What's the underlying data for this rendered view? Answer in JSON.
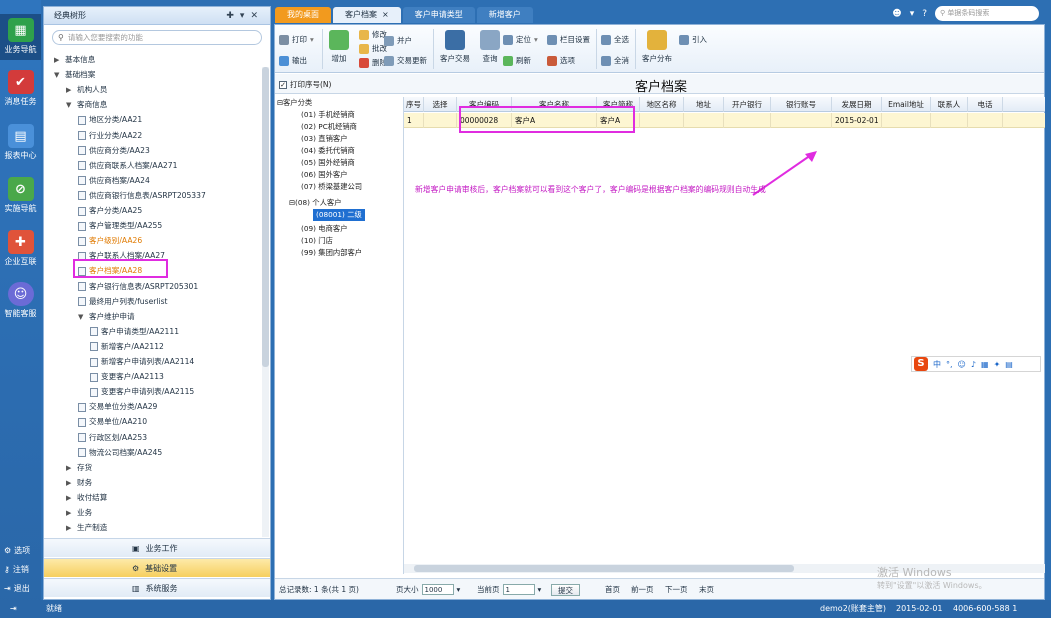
{
  "rail": {
    "items": [
      {
        "label": "业务导航",
        "icon": "grid-icon",
        "color": "#2fa14b",
        "active": true
      },
      {
        "label": "消息任务",
        "icon": "checklist-icon",
        "color": "#d33b3b"
      },
      {
        "label": "报表中心",
        "icon": "chart-icon",
        "color": "#4a90d9"
      },
      {
        "label": "实施导航",
        "icon": "compass-icon",
        "color": "#4aa84a"
      },
      {
        "label": "企业互联",
        "icon": "puzzle-icon",
        "color": "#e0533a"
      },
      {
        "label": "智能客服",
        "icon": "robot-icon",
        "color": "#6b6bd6"
      }
    ],
    "bottom": [
      "选项",
      "注销",
      "退出"
    ]
  },
  "tree_panel": {
    "title": "经典树形",
    "search_placeholder": "请输入您要搜索的功能",
    "rows": [
      {
        "label": "基本信息",
        "arrow": "▶",
        "indent": 0
      },
      {
        "label": "基础档案",
        "arrow": "▼",
        "indent": 0
      },
      {
        "label": "机构人员",
        "arrow": "▶",
        "indent": 1
      },
      {
        "label": "客商信息",
        "arrow": "▼",
        "indent": 1
      },
      {
        "label": "地区分类/AA21",
        "doc": true,
        "indent": 2
      },
      {
        "label": "行业分类/AA22",
        "doc": true,
        "indent": 2
      },
      {
        "label": "供应商分类/AA23",
        "doc": true,
        "indent": 2
      },
      {
        "label": "供应商联系人档案/AA271",
        "doc": true,
        "indent": 2
      },
      {
        "label": "供应商档案/AA24",
        "doc": true,
        "indent": 2
      },
      {
        "label": "供应商银行信息表/ASRPT205337",
        "doc": true,
        "indent": 2
      },
      {
        "label": "客户分类/AA25",
        "doc": true,
        "indent": 2
      },
      {
        "label": "客户管理类型/AA255",
        "doc": true,
        "indent": 2
      },
      {
        "label": "客户级别/AA26",
        "doc": true,
        "indent": 2,
        "orange": true
      },
      {
        "label": "客户联系人档案/AA27",
        "doc": true,
        "indent": 2
      },
      {
        "label": "客户档案/AA28",
        "doc": true,
        "indent": 2,
        "orange": true
      },
      {
        "label": "客户银行信息表/ASRPT205301",
        "doc": true,
        "indent": 2
      },
      {
        "label": "最终用户列表/fuserlist",
        "doc": true,
        "indent": 2
      },
      {
        "label": "客户维护申请",
        "arrow": "▼",
        "indent": 2
      },
      {
        "label": "客户申请类型/AA2111",
        "doc": true,
        "indent": 3
      },
      {
        "label": "新增客户/AA2112",
        "doc": true,
        "indent": 3
      },
      {
        "label": "新增客户申请列表/AA2114",
        "doc": true,
        "indent": 3
      },
      {
        "label": "变更客户/AA2113",
        "doc": true,
        "indent": 3
      },
      {
        "label": "变更客户申请列表/AA2115",
        "doc": true,
        "indent": 3
      },
      {
        "label": "交易单位分类/AA29",
        "doc": true,
        "indent": 2
      },
      {
        "label": "交易单位/AA210",
        "doc": true,
        "indent": 2
      },
      {
        "label": "行政区划/AA253",
        "doc": true,
        "indent": 2
      },
      {
        "label": "物流公司档案/AA245",
        "doc": true,
        "indent": 2
      },
      {
        "label": "存货",
        "arrow": "▶",
        "indent": 1
      },
      {
        "label": "财务",
        "arrow": "▶",
        "indent": 1
      },
      {
        "label": "收付结算",
        "arrow": "▶",
        "indent": 1
      },
      {
        "label": "业务",
        "arrow": "▶",
        "indent": 1
      },
      {
        "label": "生产制造",
        "arrow": "▶",
        "indent": 1
      }
    ],
    "nav_buttons": [
      {
        "label": "业务工作",
        "active": false
      },
      {
        "label": "基础设置",
        "active": true
      },
      {
        "label": "系统服务",
        "active": false
      }
    ]
  },
  "tabs": [
    {
      "label": "我的桌面",
      "kind": "home"
    },
    {
      "label": "客户档案",
      "kind": "active",
      "close": "×"
    },
    {
      "label": "客户申请类型",
      "kind": "inactive"
    },
    {
      "label": "新增客户",
      "kind": "inactive"
    }
  ],
  "topbar": {
    "search_placeholder": "单据条码搜索"
  },
  "toolbar": {
    "small_left": [
      "打印",
      "输出"
    ],
    "add": "增加",
    "edit_group": [
      "修改",
      "批改",
      "删除"
    ],
    "share_group": [
      "并户",
      "交易更新"
    ],
    "big_mid": [
      "客户交易",
      "查询"
    ],
    "locate_group": [
      "定位",
      "刷新"
    ],
    "col_group": [
      "栏目设置",
      "选项"
    ],
    "select_group": [
      "全选",
      "全消"
    ],
    "distribution": "客户分布",
    "import": "引入"
  },
  "doc": {
    "print_seq": "打印序号(N)",
    "title": "客户档案"
  },
  "categories": [
    "客户分类",
    "(01) 手机经销商",
    "(02) PC机经销商",
    "(03) 直销客户",
    "(04) 委托代销商",
    "(05) 国外经销商",
    "(06) 国外客户",
    "(07) 桥梁基建公司",
    "(08) 个人客户",
    "(08001) 二级",
    "(09) 电商客户",
    "(10) 门店",
    "(99) 集团内部客户"
  ],
  "grid": {
    "columns": [
      "序号",
      "选择",
      "客户编码",
      "客户名称",
      "客户简称",
      "地区名称",
      "地址",
      "开户银行",
      "银行账号",
      "发展日期",
      "Email地址",
      "联系人",
      "电话"
    ],
    "rows": [
      [
        "1",
        "",
        "00000028",
        "客户A",
        "客户A",
        "",
        "",
        "",
        "",
        "2015-02-01",
        "",
        "",
        ""
      ]
    ]
  },
  "annotation": "新增客户申请审核后，客户档案就可以看到这个客户了，客户编码是根据客户档案的编码规则自动生成",
  "ime": {
    "logo": "S",
    "label": "中"
  },
  "footer": {
    "records": "总记录数: 1 条(共 1 页)",
    "page_size_label": "页大小",
    "page_size": "1000",
    "current_label": "当前页",
    "current_page": "1",
    "jump": "提交",
    "first": "首页",
    "prev": "前一页",
    "next": "下一页",
    "last": "末页"
  },
  "watermark": {
    "line1": "激活 Windows",
    "line2": "转到\"设置\"以激活 Windows。"
  },
  "status": {
    "left": "就绪",
    "user": "demo2(账套主管)",
    "date": "2015-02-01",
    "phone": "4006-600-588 1"
  },
  "colors": {
    "highlight": "#e02ce0",
    "accent": "#2a67a8",
    "tab_home": "#f29a1e",
    "annotation": "#c318c3"
  }
}
